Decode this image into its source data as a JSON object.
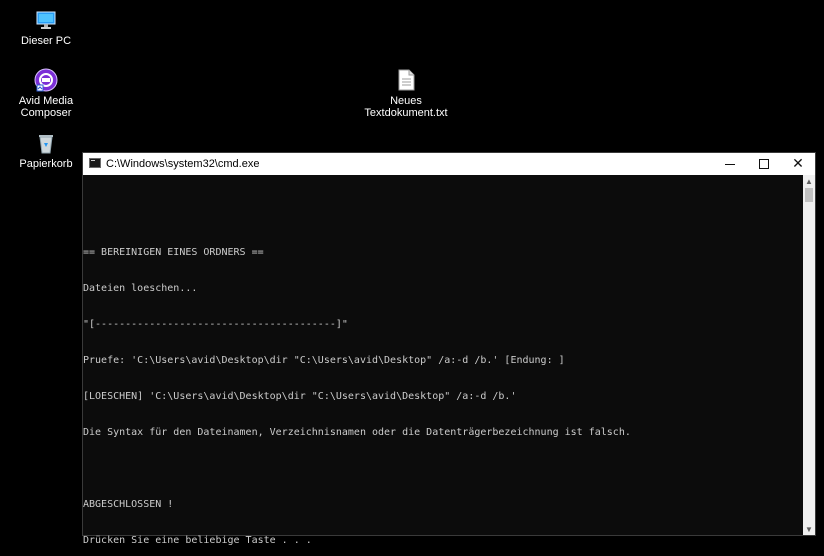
{
  "desktop": {
    "icons": [
      {
        "label": "Dieser PC",
        "icon": "computer-icon"
      },
      {
        "label": "Avid Media\nComposer",
        "icon": "avid-app-icon"
      },
      {
        "label": "Papierkorb",
        "icon": "recycle-bin-icon"
      },
      {
        "label": "Neues\nTextdokument.txt",
        "icon": "text-file-icon"
      }
    ]
  },
  "window": {
    "title": "C:\\Windows\\system32\\cmd.exe",
    "controls": {
      "minimize": "minimize-icon",
      "maximize": "maximize-icon",
      "close": "close-icon"
    }
  },
  "console": {
    "lines": [
      "",
      "== BEREINIGEN EINES ORDNERS ==",
      "Dateien loeschen...",
      "\"[----------------------------------------]\"",
      "Pruefe: 'C:\\Users\\avid\\Desktop\\dir \"C:\\Users\\avid\\Desktop\" /a:-d /b.' [Endung: ]",
      "[LOESCHEN] 'C:\\Users\\avid\\Desktop\\dir \"C:\\Users\\avid\\Desktop\" /a:-d /b.'",
      "Die Syntax für den Dateinamen, Verzeichnisnamen oder die Datenträgerbezeichnung ist falsch.",
      "",
      "ABGESCHLOSSEN !",
      "Drücken Sie eine beliebige Taste . . ."
    ]
  },
  "colors": {
    "console_bg": "#0c0c0c",
    "console_text": "#cccccc",
    "titlebar_bg": "#ffffff",
    "desktop_bg": "#000000"
  }
}
